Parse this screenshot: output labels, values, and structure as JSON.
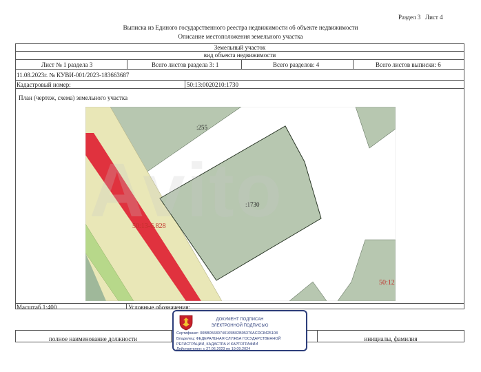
{
  "header": {
    "section": "Раздел 3",
    "sheet": "Лист 4",
    "title": "Выписка из Единого государственного реестра недвижимости об объекте недвижимости",
    "subtitle": "Описание местоположения земельного участка"
  },
  "table": {
    "object_type": "Земельный участок",
    "object_type_caption": "вид объекта недвижимости",
    "sheet_no": "Лист № 1 раздела 3",
    "total_sheets_section": "Всего листов раздела 3: 1",
    "total_sections": "Всего разделов: 4",
    "total_sheets_extract": "Всего листов выписки: 6",
    "date_number": "11.08.2023г. № КУВИ-001/2023-183663687",
    "cadastral_label": "Кадастровый номер:",
    "cadastral_value": "50:13:0020210:1730",
    "plan_label": "План (чертеж, схема) земельного участка",
    "scale": "Масштаб 1:400",
    "legend_label": "Условные обозначения:",
    "position_label": "полное наименование должности",
    "name_label": "инициалы, фамилия"
  },
  "map": {
    "labels": {
      "parcel_255": ":255",
      "parcel_1730": ":1730",
      "road": "50:13-6.828",
      "parcel_right": "50:12"
    },
    "colors": {
      "parcel_fill": "#b7c7b0",
      "parcel_stroke": "#2d3a2a",
      "road_fill": "#e9e7b7",
      "road_red": "#e0323e",
      "road_green": "#b7d88a",
      "watermark": "#e4e4e4"
    },
    "watermark_text": "Avito"
  },
  "stamp": {
    "title": "ДОКУМЕНТ ПОДПИСАН",
    "subtitle": "ЭЛЕКТРОННОЙ ПОДПИСЬЮ",
    "certificate": "Сертификат: 00BB05680740105B02B05376ACDC8425108",
    "owner_line1": "Владелец: ФЕДЕРАЛЬНАЯ СЛУЖБА ГОСУДАРСТВЕННОЙ",
    "owner_line2": "РЕГИСТРАЦИИ, КАДАСТРА И КАРТОГРАФИИ",
    "valid": "Действителен: с 27.06.2023 по 19.09.2024",
    "emblem_icon": "coat-of-arms-icon"
  }
}
